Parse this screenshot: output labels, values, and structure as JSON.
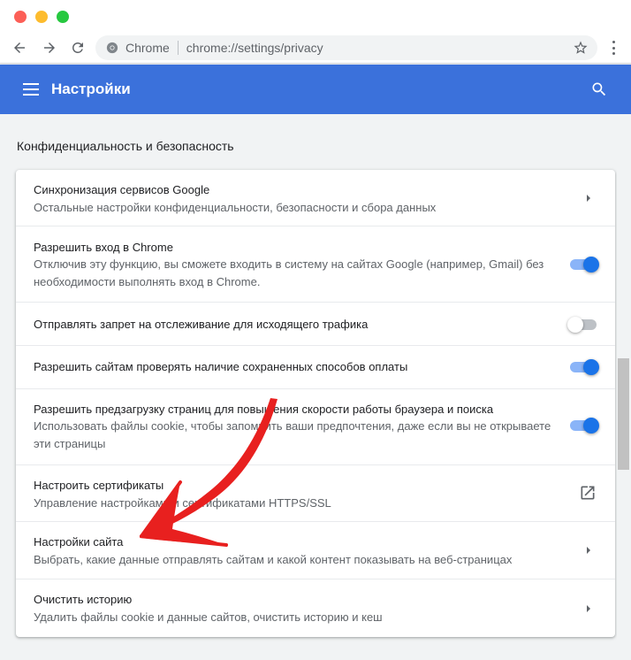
{
  "browser": {
    "site_label": "Chrome",
    "url": "chrome://settings/privacy",
    "icons": {
      "back": "arrow-back-icon",
      "forward": "arrow-forward-icon",
      "reload": "reload-icon",
      "star": "bookmark-star-icon",
      "menu": "vertical-dots-icon"
    }
  },
  "header": {
    "title": "Настройки",
    "menu_icon": "hamburger-icon",
    "search_icon": "search-icon",
    "color": "#3b71db"
  },
  "section": {
    "title": "Конфиденциальность и безопасность"
  },
  "rows": [
    {
      "primary": "Синхронизация сервисов Google",
      "secondary": "Остальные настройки конфиденциальности, безопасности и сбора данных",
      "control": "chevron"
    },
    {
      "primary": "Разрешить вход в Chrome",
      "secondary": "Отключив эту функцию, вы сможете входить в систему на сайтах Google (например, Gmail) без необходимости выполнять вход в Chrome.",
      "control": "toggle",
      "enabled": true
    },
    {
      "primary": "Отправлять запрет на отслеживание для исходящего трафика",
      "secondary": "",
      "control": "toggle",
      "enabled": false
    },
    {
      "primary": "Разрешить сайтам проверять наличие сохраненных способов оплаты",
      "secondary": "",
      "control": "toggle",
      "enabled": true
    },
    {
      "primary": "Разрешить предзагрузку страниц для повышения скорости работы браузера и поиска",
      "secondary": "Использовать файлы cookie, чтобы запомнить ваши предпочтения, даже если вы не открываете эти страницы",
      "control": "toggle",
      "enabled": true
    },
    {
      "primary": "Настроить сертификаты",
      "secondary": "Управление настройками и сертификатами HTTPS/SSL",
      "control": "external-link"
    },
    {
      "primary": "Настройки сайта",
      "secondary": "Выбрать, какие данные отправлять сайтам и какой контент показывать на веб-страницах",
      "control": "chevron"
    },
    {
      "primary": "Очистить историю",
      "secondary": "Удалить файлы cookie и данные сайтов, очистить историю и кеш",
      "control": "chevron"
    }
  ],
  "annotation": {
    "icon": "red-arrow-annotation",
    "color": "#e8201f"
  },
  "colors": {
    "toggle_on": "#1a73e8",
    "toggle_on_track": "#8ab4f8",
    "toggle_off_track": "#bdc1c6"
  }
}
